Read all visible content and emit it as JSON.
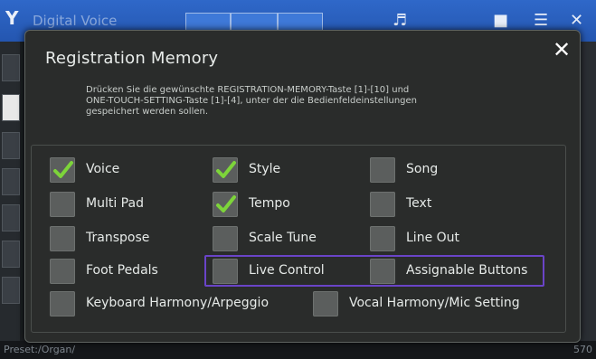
{
  "background": {
    "title": "Digital Voice",
    "footer_path": "Preset:/Organ/",
    "footer_right": "570"
  },
  "dialog": {
    "title": "Registration Memory",
    "close_icon": "close-icon",
    "description": [
      "Drücken Sie die gewünschte REGISTRATION-MEMORY-Taste [1]-[10] und",
      "ONE-TOUCH-SETTING-Taste [1]-[4], unter der die Bedienfeldeinstellungen",
      "gespeichert werden sollen."
    ],
    "options": [
      {
        "label": "Voice",
        "checked": true
      },
      {
        "label": "Style",
        "checked": true
      },
      {
        "label": "Song",
        "checked": false
      },
      {
        "label": "Multi Pad",
        "checked": false
      },
      {
        "label": "Tempo",
        "checked": true
      },
      {
        "label": "Text",
        "checked": false
      },
      {
        "label": "Transpose",
        "checked": false
      },
      {
        "label": "Scale Tune",
        "checked": false
      },
      {
        "label": "Line Out",
        "checked": false
      },
      {
        "label": "Foot Pedals",
        "checked": false
      },
      {
        "label": "Live Control",
        "checked": false
      },
      {
        "label": "Assignable Buttons",
        "checked": false
      },
      {
        "label": "Keyboard Harmony/Arpeggio",
        "checked": false
      },
      {
        "label": "Vocal Harmony/Mic Setting",
        "checked": false
      }
    ]
  },
  "colors": {
    "check": "#7dd43a",
    "highlight_border": "#6a44c8",
    "topbar": "#2b62c0"
  }
}
